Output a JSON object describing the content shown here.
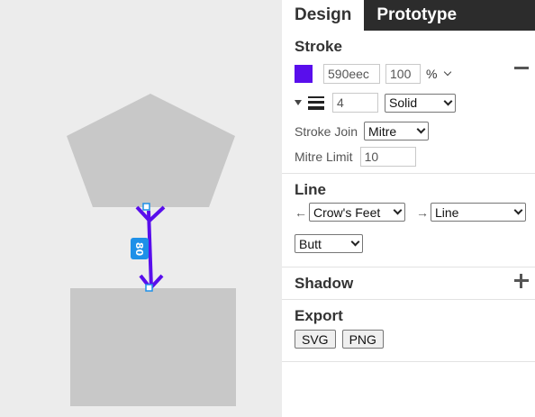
{
  "tabs": {
    "design": "Design",
    "prototype": "Prototype"
  },
  "stroke": {
    "title": "Stroke",
    "color_hex": "590eec",
    "color": "#590eec",
    "opacity": "100",
    "opacity_unit": "%",
    "width": "4",
    "style": "Solid",
    "join_label": "Stroke Join",
    "join": "Mitre",
    "mitre_label": "Mitre Limit",
    "mitre": "10"
  },
  "line": {
    "title": "Line",
    "start_marker": "Crow's Feet",
    "end_marker": "Line",
    "cap": "Butt",
    "start_arrow": "←",
    "end_arrow": "→"
  },
  "shadow": {
    "title": "Shadow"
  },
  "export": {
    "title": "Export",
    "svg": "SVG",
    "png": "PNG"
  },
  "canvas": {
    "measure": "80",
    "shape_color": "#c8c8c8",
    "connector_color": "#590eec",
    "handle_color": "#1e90e8"
  }
}
